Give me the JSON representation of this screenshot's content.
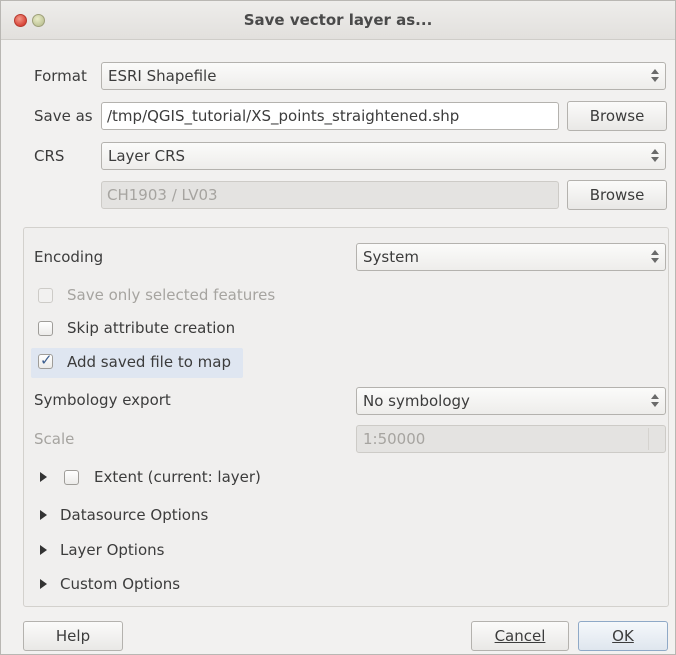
{
  "window": {
    "title": "Save vector layer as..."
  },
  "format": {
    "label": "Format",
    "value": "ESRI Shapefile"
  },
  "save_as": {
    "label": "Save as",
    "value": "/tmp/QGIS_tutorial/XS_points_straightened.shp",
    "browse": "Browse"
  },
  "crs": {
    "label": "CRS",
    "value": "Layer CRS",
    "crs_value": "CH1903 / LV03",
    "browse": "Browse"
  },
  "encoding": {
    "label": "Encoding",
    "value": "System"
  },
  "options": {
    "save_selected": {
      "label": "Save only selected features",
      "checked": false,
      "enabled": false
    },
    "skip_attr": {
      "label": "Skip attribute creation",
      "checked": false
    },
    "add_to_map": {
      "label": "Add saved file to map",
      "checked": true
    }
  },
  "symbology": {
    "label": "Symbology export",
    "value": "No symbology"
  },
  "scale": {
    "label": "Scale",
    "value": "1:50000"
  },
  "groups": {
    "extent": "Extent (current: layer)",
    "datasource": "Datasource Options",
    "layer": "Layer Options",
    "custom": "Custom Options"
  },
  "buttons": {
    "help": "Help",
    "cancel": "Cancel",
    "ok": "OK"
  }
}
